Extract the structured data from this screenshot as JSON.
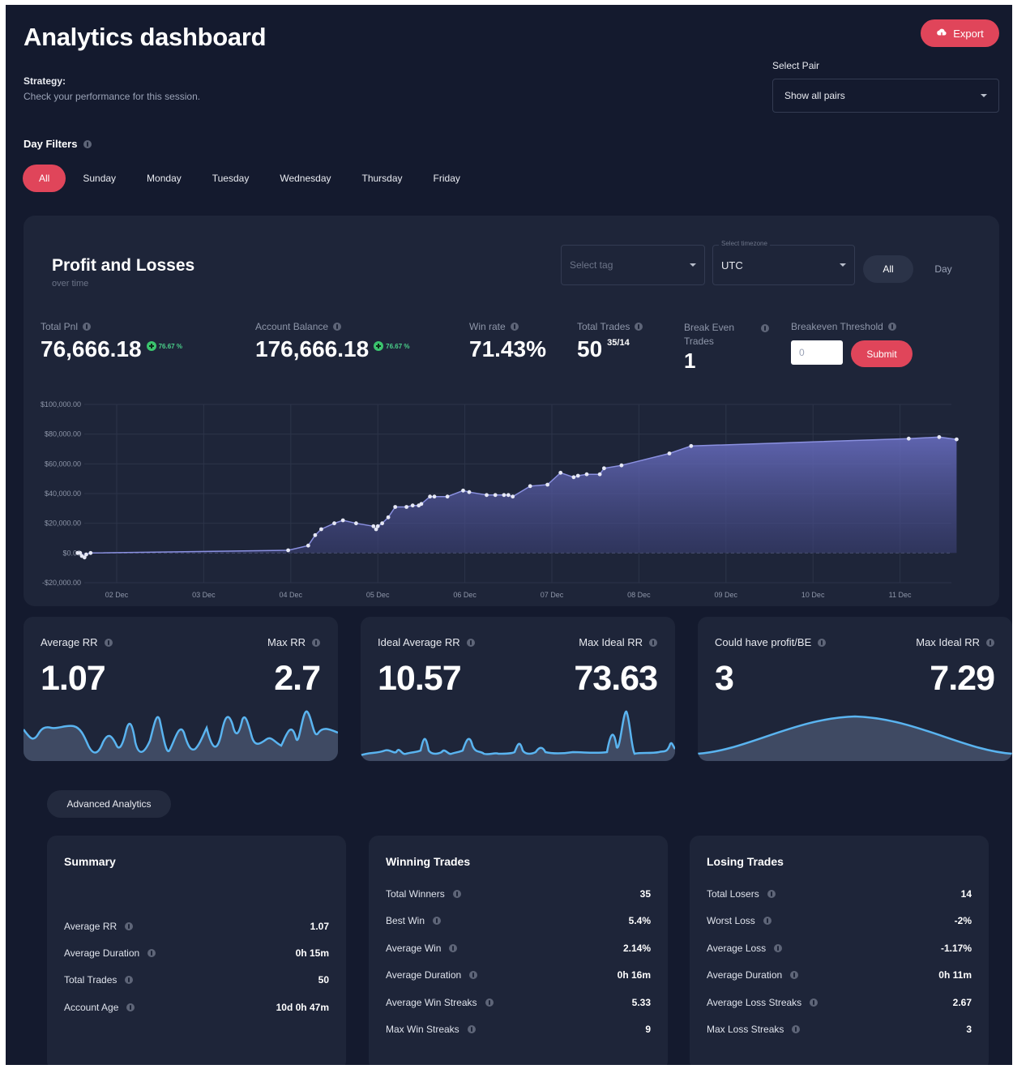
{
  "header": {
    "title": "Analytics dashboard",
    "strategy_label": "Strategy:",
    "strategy_desc": "Check your performance for this session.",
    "export_label": "Export",
    "select_pair_label": "Select Pair",
    "select_pair_value": "Show all pairs"
  },
  "day_filters": {
    "label": "Day Filters",
    "items": [
      "All",
      "Sunday",
      "Monday",
      "Tuesday",
      "Wednesday",
      "Thursday",
      "Friday"
    ],
    "active": "All"
  },
  "pnl": {
    "title": "Profit and Losses",
    "subtitle": "over time",
    "tag_placeholder": "Select tag",
    "timezone_legend": "Select timezone",
    "timezone_value": "UTC",
    "toggle_all": "All",
    "toggle_day": "Day",
    "stats": {
      "total_pnl_label": "Total Pnl",
      "total_pnl_value": "76,666.18",
      "total_pnl_badge": "76.67 %",
      "balance_label": "Account Balance",
      "balance_value": "176,666.18",
      "balance_badge": "76.67 %",
      "winrate_label": "Win rate",
      "winrate_value": "71.43%",
      "trades_label": "Total Trades",
      "trades_value": "50",
      "trades_sup": "35/14",
      "breakeven_label_1": "Break Even",
      "breakeven_label_2": "Trades",
      "breakeven_value": "1",
      "threshold_label": "Breakeven Threshold",
      "threshold_value": "0",
      "submit_label": "Submit"
    }
  },
  "chart_data": {
    "type": "area",
    "title": "",
    "xlabel": "",
    "ylabel": "",
    "x_ticks": [
      "02 Dec",
      "03 Dec",
      "04 Dec",
      "05 Dec",
      "06 Dec",
      "07 Dec",
      "08 Dec",
      "09 Dec",
      "10 Dec",
      "11 Dec"
    ],
    "y_ticks": [
      "$100,000.00",
      "$80,000.00",
      "$60,000.00",
      "$40,000.00",
      "$20,000.00",
      "$0.00",
      "-$20,000.00"
    ],
    "ylim": [
      -20000,
      100000
    ],
    "xlim": [
      1.55,
      11.65
    ],
    "grid": true,
    "series": [
      {
        "x": [
          1.55,
          1.58,
          1.6,
          1.63,
          1.65,
          1.7,
          3.97,
          4.2,
          4.28,
          4.35,
          4.5,
          4.6,
          4.75,
          4.95,
          4.98,
          5.0,
          5.05,
          5.12,
          5.2,
          5.33,
          5.4,
          5.47,
          5.5,
          5.6,
          5.65,
          5.8,
          5.98,
          6.05,
          6.25,
          6.35,
          6.45,
          6.5,
          6.55,
          6.75,
          6.95,
          7.1,
          7.25,
          7.3,
          7.4,
          7.55,
          7.6,
          7.8,
          8.35,
          8.6,
          11.1,
          11.45,
          11.65
        ],
        "y": [
          0,
          0,
          -2000,
          -3000,
          -1000,
          0,
          1800,
          5000,
          12000,
          16000,
          20000,
          22000,
          20000,
          18000,
          16000,
          18000,
          20000,
          24000,
          31000,
          31000,
          32000,
          32000,
          33000,
          38000,
          38000,
          38000,
          42000,
          41000,
          39000,
          39000,
          39000,
          39000,
          38000,
          45000,
          46000,
          54000,
          51000,
          52000,
          53000,
          53000,
          57000,
          59000,
          67000,
          72000,
          77000,
          78000,
          76500
        ]
      }
    ]
  },
  "mini_cards": [
    {
      "left_label": "Average RR",
      "left_value": "1.07",
      "right_label": "Max RR",
      "right_value": "2.7"
    },
    {
      "left_label": "Ideal Average RR",
      "left_value": "10.57",
      "right_label": "Max Ideal RR",
      "right_value": "73.63"
    },
    {
      "left_label": "Could have profit/BE",
      "left_value": "3",
      "right_label": "Max Ideal RR",
      "right_value": "7.29"
    }
  ],
  "advanced_label": "Advanced Analytics",
  "summary": {
    "title": "Summary",
    "rows": [
      {
        "k": "Average RR",
        "v": "1.07"
      },
      {
        "k": "Average Duration",
        "v": "0h 15m"
      },
      {
        "k": "Total Trades",
        "v": "50"
      },
      {
        "k": "Account Age",
        "v": "10d 0h 47m"
      }
    ]
  },
  "winning": {
    "title": "Winning Trades",
    "rows": [
      {
        "k": "Total Winners",
        "v": "35"
      },
      {
        "k": "Best Win",
        "v": "5.4%"
      },
      {
        "k": "Average Win",
        "v": "2.14%"
      },
      {
        "k": "Average Duration",
        "v": "0h 16m"
      },
      {
        "k": "Average Win Streaks",
        "v": "5.33"
      },
      {
        "k": "Max Win Streaks",
        "v": "9"
      }
    ]
  },
  "losing": {
    "title": "Losing Trades",
    "rows": [
      {
        "k": "Total Losers",
        "v": "14"
      },
      {
        "k": "Worst Loss",
        "v": "-2%"
      },
      {
        "k": "Average Loss",
        "v": "-1.17%"
      },
      {
        "k": "Average Duration",
        "v": "0h 11m"
      },
      {
        "k": "Average Loss Streaks",
        "v": "2.67"
      },
      {
        "k": "Max Loss Streaks",
        "v": "3"
      }
    ]
  },
  "colors": {
    "background": "#141a2e",
    "card": "#1e2539",
    "accent": "#e0455a",
    "chart_line": "#7c83d6",
    "sparkline": "#5ab4f0",
    "positive": "#3bc46e"
  }
}
